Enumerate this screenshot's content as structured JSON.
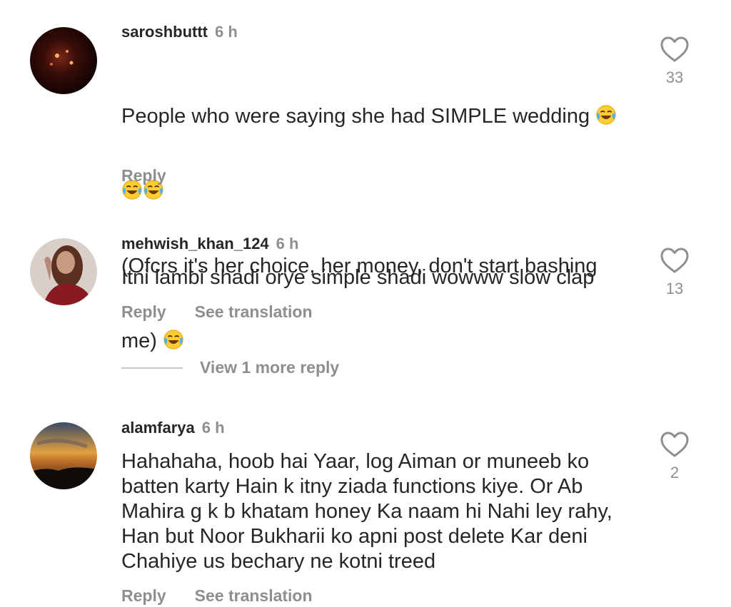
{
  "comments": [
    {
      "username": "saroshbuttt",
      "time": "6 h",
      "text_line1": "People who were saying she had SIMPLE wedding ",
      "text_line3": "(Ofcrs it's her choice, her money, don't start bashing",
      "text_line4": "me) ",
      "reply_label": "Reply",
      "likes": "33"
    },
    {
      "username": "mehwish_khan_124",
      "time": "6 h",
      "text": "Itni lambi shadi orye simple shadi wowww slow clap",
      "reply_label": "Reply",
      "translation_label": "See translation",
      "likes": "13",
      "view_replies_label": "View 1 more reply"
    },
    {
      "username": "alamfarya",
      "time": "6 h",
      "text": "Hahahaha, hoob hai Yaar, log Aiman or muneeb ko\nbatten karty Hain k itny ziada functions kiye. Or Ab\nMahira g k b khatam honey Ka naam hi Nahi ley rahy,\nHan but Noor Bukharii ko apni post delete Kar deni\nChahiye us bechary ne kotni treed",
      "reply_label": "Reply",
      "translation_label": "See translation",
      "likes": "2"
    }
  ],
  "icons": {
    "like": "heart-outline-icon",
    "emoji": "face-with-tears-of-joy-emoji"
  },
  "colors": {
    "text": "#262626",
    "secondary": "#8e8e8e",
    "divider": "#c7c7c7"
  }
}
